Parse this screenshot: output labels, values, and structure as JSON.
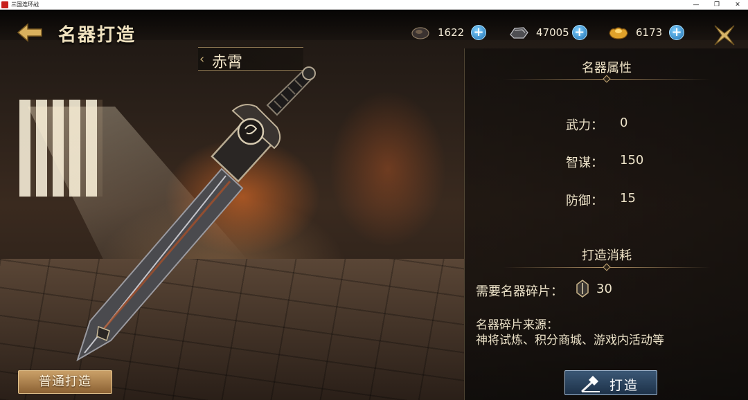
{
  "window": {
    "title": "三国连环战",
    "controls": [
      "—",
      "❐",
      "✕"
    ]
  },
  "header": {
    "title": "名器打造",
    "resources": [
      {
        "name": "iron-ore",
        "value": "1622"
      },
      {
        "name": "steel",
        "value": "47005"
      },
      {
        "name": "gold-ingot",
        "value": "6173"
      }
    ],
    "plus_label": "+"
  },
  "weapon": {
    "name": "赤霄"
  },
  "attributes": {
    "title": "名器属性",
    "items": [
      {
        "label": "武力：",
        "value": "0"
      },
      {
        "label": "智谋：",
        "value": "150"
      },
      {
        "label": "防御：",
        "value": "15"
      }
    ]
  },
  "cost": {
    "title": "打造消耗",
    "need_label": "需要名器碎片：",
    "need_value": "30",
    "source_label": "名器碎片来源：",
    "source_value": "神将试炼、积分商城、游戏内活动等"
  },
  "buttons": {
    "normal_forge": "普通打造",
    "forge": "打造"
  },
  "colors": {
    "accent_gold": "#c9ab78",
    "forge_button_blue": "#2a4563",
    "normal_button_bronze": "#a87a45",
    "plus_blue": "#2f8fd4"
  }
}
